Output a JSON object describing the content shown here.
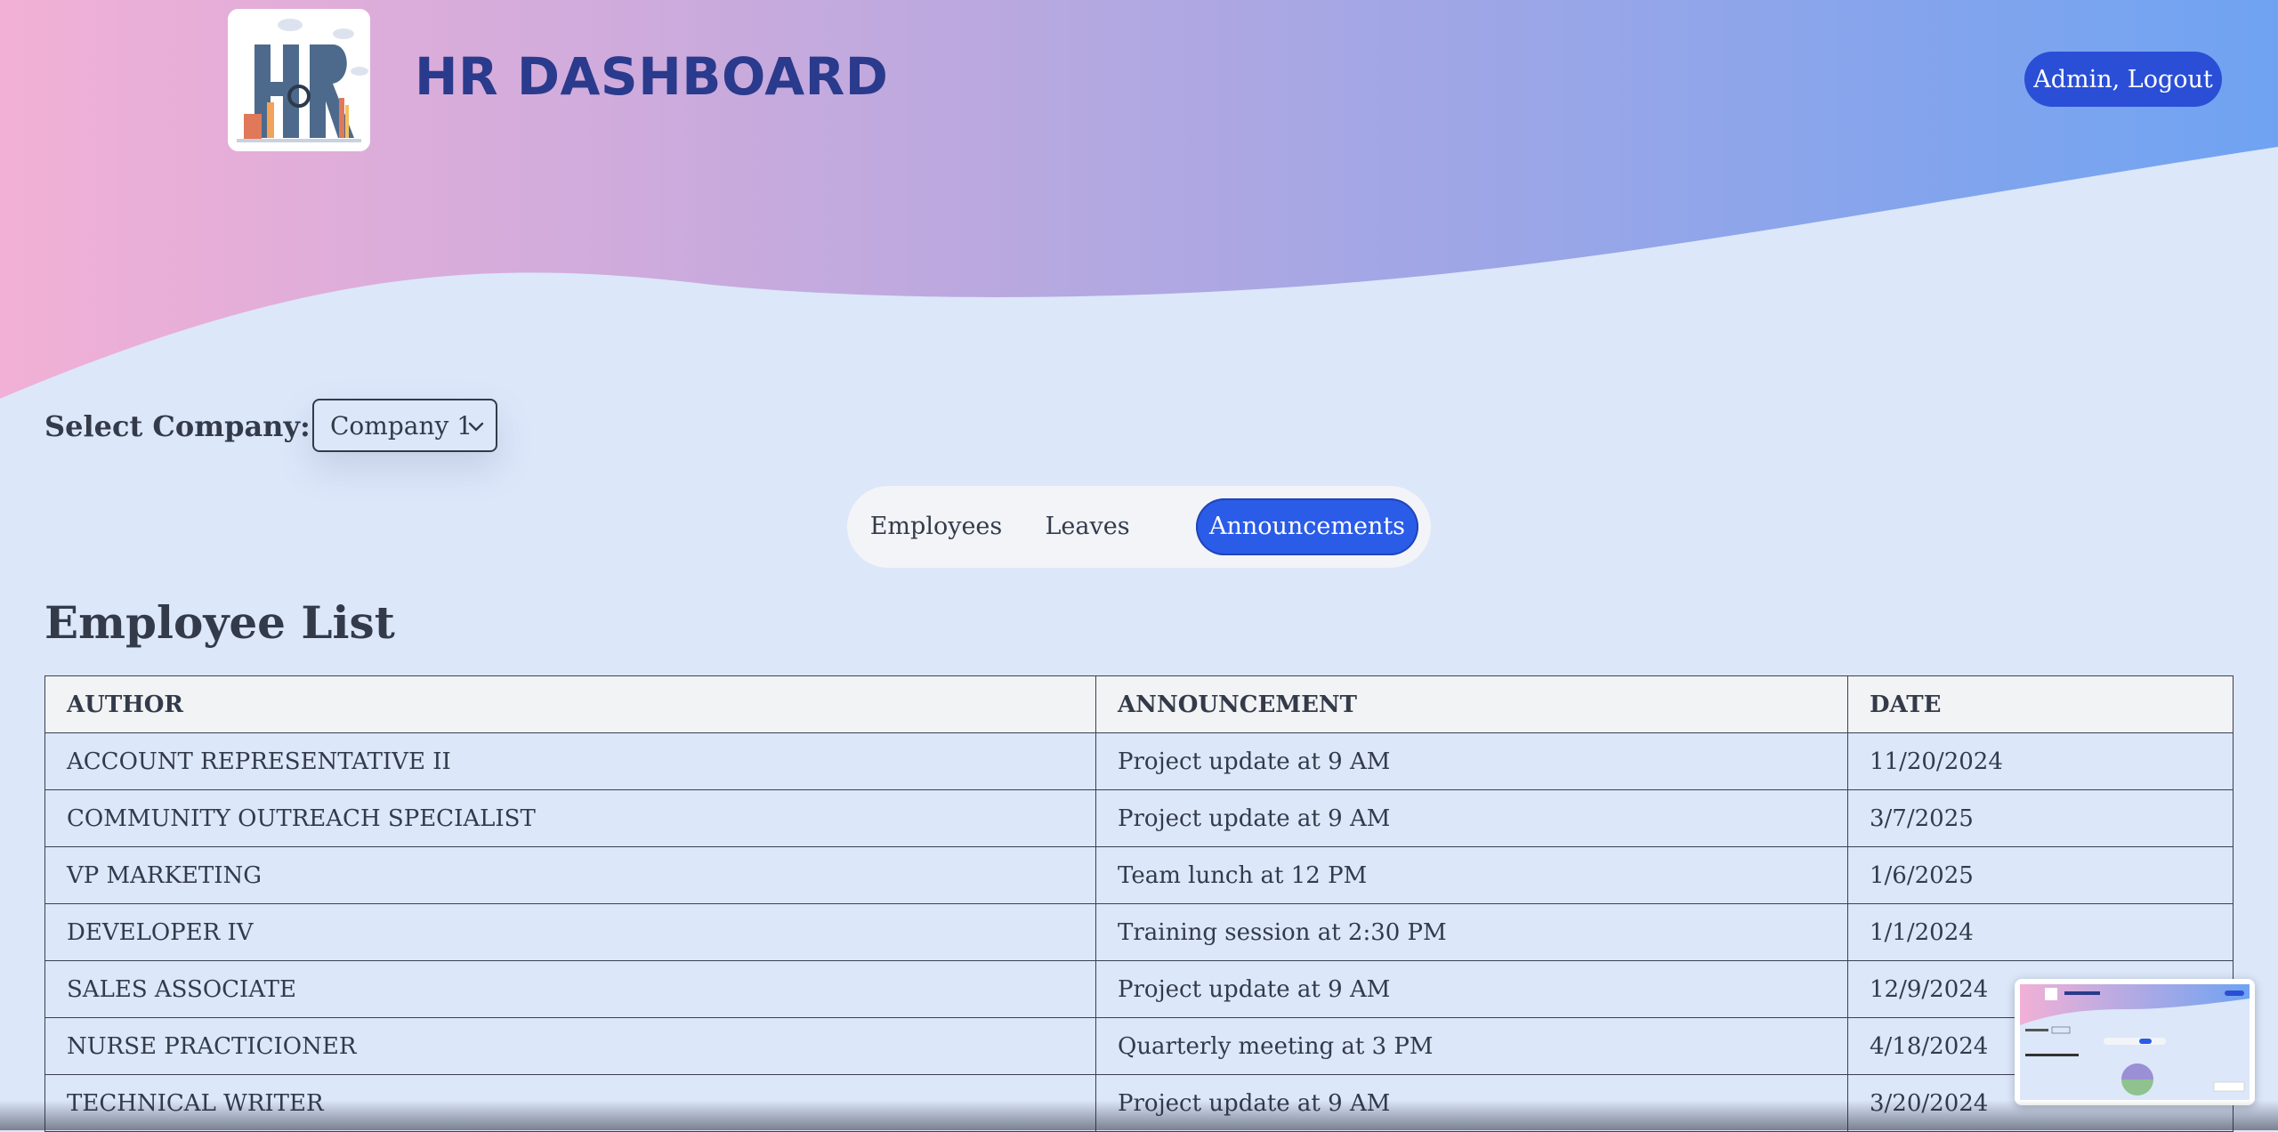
{
  "header": {
    "title": "HR DASHBOARD",
    "logo_icon": "hr-logo-icon",
    "user_button_label": "Admin, Logout",
    "gradient_start": "#f2b0d6",
    "gradient_end": "#6fa3f2"
  },
  "company_select": {
    "label": "Select Company:",
    "selected_value": "Company 1"
  },
  "tabs": [
    {
      "label": "Employees",
      "active": false
    },
    {
      "label": "Leaves",
      "active": false
    },
    {
      "label": "Announcements",
      "active": true
    }
  ],
  "section_title": "Employee List",
  "table": {
    "headers": [
      "AUTHOR",
      "ANNOUNCEMENT",
      "DATE"
    ],
    "rows": [
      [
        "ACCOUNT REPRESENTATIVE II",
        "Project update at 9 AM",
        "11/20/2024"
      ],
      [
        "COMMUNITY OUTREACH SPECIALIST",
        "Project update at 9 AM",
        "3/7/2025"
      ],
      [
        "VP MARKETING",
        "Team lunch at 12 PM",
        "1/6/2025"
      ],
      [
        "DEVELOPER IV",
        "Training session at 2:30 PM",
        "1/1/2024"
      ],
      [
        "SALES ASSOCIATE",
        "Project update at 9 AM",
        "12/9/2024"
      ],
      [
        "NURSE PRACTICIONER",
        "Quarterly meeting at 3 PM",
        "4/18/2024"
      ],
      [
        "TECHNICAL WRITER",
        "Project update at 9 AM",
        "3/20/2024"
      ]
    ]
  },
  "colors": {
    "accent": "#2a5ce8",
    "title": "#2a3a8c",
    "page_bg": "#dce7fa"
  },
  "thumbnail": {
    "icon": "screen-preview-thumbnail"
  }
}
